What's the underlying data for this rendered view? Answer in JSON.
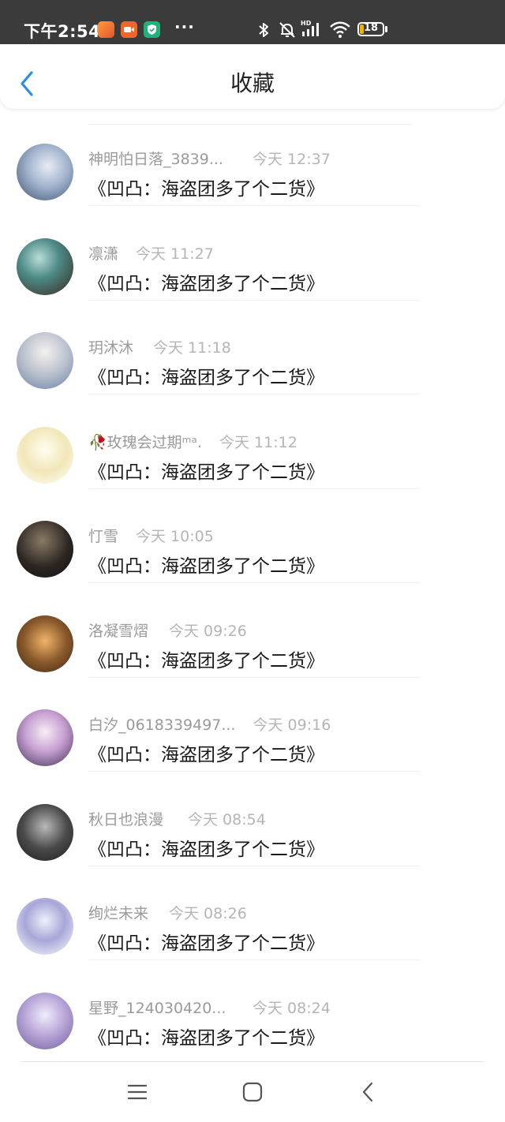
{
  "status_bar": {
    "time": "下午2:54",
    "dots": "···",
    "battery": "18",
    "battery_level": 0.18,
    "icons": [
      "orange-photo-app-icon",
      "orange-video-app-icon",
      "green-shield-app-icon",
      "bluetooth-icon",
      "mute-bell-icon",
      "hd-signal-icon",
      "wifi-icon",
      "battery-icon"
    ],
    "colors": {
      "bg": "#3b3b3b",
      "battery_fill": "#f0b400"
    }
  },
  "header": {
    "title": "收藏",
    "back_icon": "chevron-left-icon",
    "accent": "#2b8ee8"
  },
  "favorites": [
    {
      "name": "神明怕日落_3839...",
      "time": "今天 12:37",
      "content": "《凹凸：海盗团多了个二货》"
    },
    {
      "name": "凛潇",
      "time": "今天 11:27",
      "content": "《凹凸：海盗团多了个二货》"
    },
    {
      "name": "玥沐沐",
      "time": "今天 11:18",
      "content": "《凹凸：海盗团多了个二货》"
    },
    {
      "name": "🥀玫瑰会过期ᵐᵃ.",
      "time": "今天 11:12",
      "content": "《凹凸：海盗团多了个二货》"
    },
    {
      "name": "忊雪",
      "time": "今天 10:05",
      "content": "《凹凸：海盗团多了个二货》"
    },
    {
      "name": "洛凝雪熠",
      "time": "今天 09:26",
      "content": "《凹凸：海盗团多了个二货》"
    },
    {
      "name": "白汐_0618339497...",
      "time": "今天 09:16",
      "content": "《凹凸：海盗团多了个二货》"
    },
    {
      "name": "秋日也浪漫",
      "time": "今天 08:54",
      "content": "《凹凸：海盗团多了个二货》"
    },
    {
      "name": "绚烂未来",
      "time": "今天 08:26",
      "content": "《凹凸：海盗团多了个二货》"
    },
    {
      "name": "星野_124030420...",
      "time": "今天 08:24",
      "content": "《凹凸：海盗团多了个二货》"
    }
  ],
  "nav_bar": {
    "icons": [
      "menu-icon",
      "home-icon",
      "back-icon"
    ]
  }
}
